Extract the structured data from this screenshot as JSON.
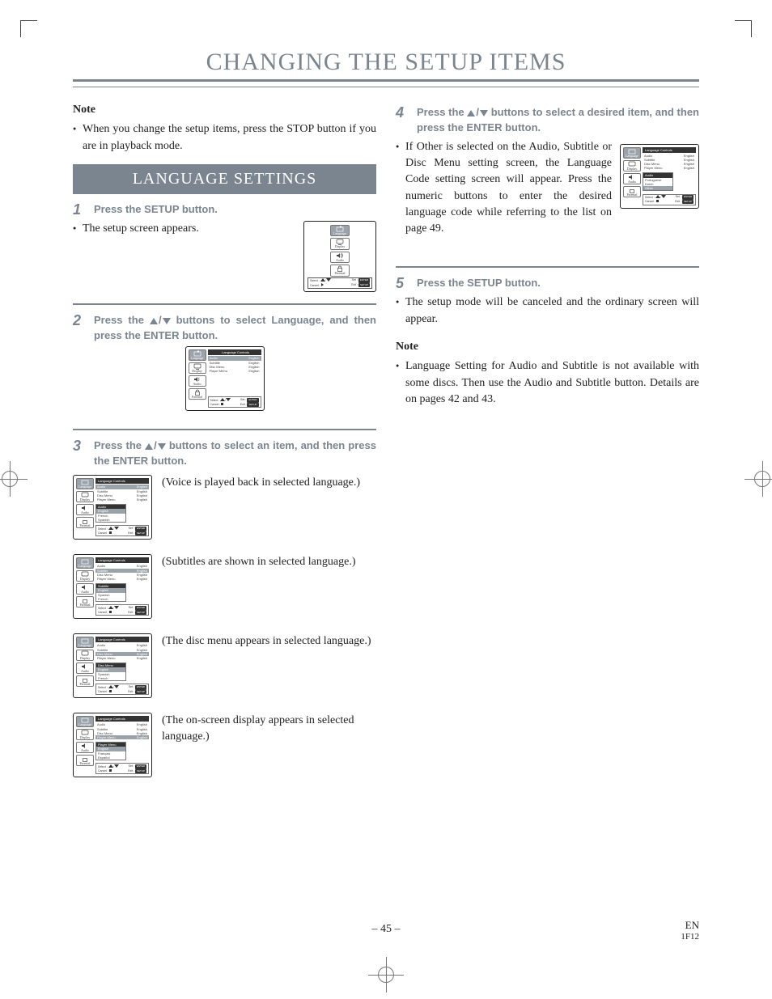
{
  "title": "CHANGING THE SETUP ITEMS",
  "note_label": "Note",
  "intro_bullets": [
    "When you change the setup items, press the STOP button if you are in playback mode."
  ],
  "section_heading": "LANGUAGE SETTINGS",
  "steps": {
    "s1": {
      "num": "1",
      "text": "Press the SETUP button."
    },
    "s1_after": "The setup screen appears.",
    "s2": {
      "num": "2",
      "text_a": "Press the ",
      "text_b": " buttons to select Language, and then press the ENTER button."
    },
    "s3": {
      "num": "3",
      "text_a": "Press the ",
      "text_b": " buttons to select an item, and then press the ENTER button."
    },
    "s4": {
      "num": "4",
      "text_a": "Press the ",
      "text_b": " buttons to select a desired item, and then press the ENTER button."
    },
    "s4_bullets": [
      "If Other is selected on the Audio, Subtitle or Disc Menu setting screen, the Language Code setting screen will appear. Press the numeric buttons to enter the desired language code while referring to the list on page 49."
    ],
    "s5": {
      "num": "5",
      "text": "Press the SETUP button."
    },
    "s5_after": "The setup mode will be canceled and the ordinary screen will appear.",
    "end_note_bullets": [
      "Language Setting for Audio and Subtitle is not available with some discs. Then use the Audio and Subtitle button. Details are on pages 42 and 43."
    ]
  },
  "osd": {
    "side_labels": {
      "language": "Language",
      "display": "Display",
      "audio": "Audio",
      "parental": "Parental"
    },
    "panel_title": "Language Controls",
    "rows": {
      "audio": "Audio",
      "subtitle": "Subtitle",
      "disc_menu": "Disc Menu",
      "player_menu": "Player Menu"
    },
    "value_english": "English",
    "audio_opts": [
      "English",
      "French",
      "Spanish"
    ],
    "audio_opts_other": [
      "Portuguese",
      "Dutch",
      "Other"
    ],
    "subtitle_opts": [
      "English",
      "Spanish",
      "French"
    ],
    "discmenu_opts": [
      "English",
      "Spanish",
      "French"
    ],
    "player_opts": [
      "English",
      "Français",
      "Español"
    ],
    "footer": {
      "select": "Select :",
      "set": "Set :",
      "cancel": "Cancel :",
      "exit": "Exit :",
      "enter": "ENTER",
      "setup": "SETUP"
    }
  },
  "captions": {
    "audio": "(Voice is played back in selected language.)",
    "subtitle": "(Subtitles are shown in selected language.)",
    "disc_menu": "(The disc menu appears in selected language.)",
    "player_menu": "(The on-screen display appears in selected language.)"
  },
  "page_number": "– 45 –",
  "footer_right": {
    "en": "EN",
    "code": "1F12"
  }
}
